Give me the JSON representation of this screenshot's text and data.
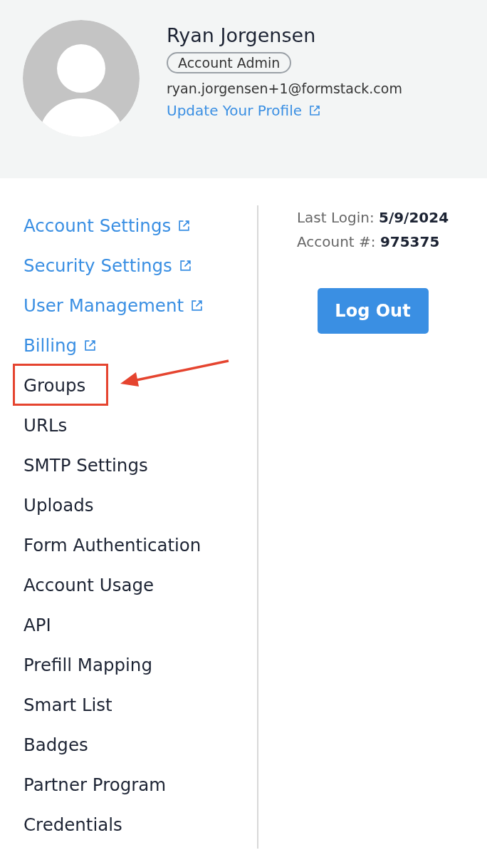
{
  "profile": {
    "name": "Ryan Jorgensen",
    "role": "Account Admin",
    "email": "ryan.jorgensen+1@formstack.com",
    "link": "Update Your Profile"
  },
  "menu": [
    {
      "label": "Account Settings",
      "external": true,
      "highlighted": false
    },
    {
      "label": "Security Settings",
      "external": true,
      "highlighted": false
    },
    {
      "label": "User Management",
      "external": true,
      "highlighted": false
    },
    {
      "label": "Billing",
      "external": true,
      "highlighted": false
    },
    {
      "label": "Groups",
      "external": false,
      "highlighted": true
    },
    {
      "label": "URLs",
      "external": false,
      "highlighted": false
    },
    {
      "label": "SMTP Settings",
      "external": false,
      "highlighted": false
    },
    {
      "label": "Uploads",
      "external": false,
      "highlighted": false
    },
    {
      "label": "Form Authentication",
      "external": false,
      "highlighted": false
    },
    {
      "label": "Account Usage",
      "external": false,
      "highlighted": false
    },
    {
      "label": "API",
      "external": false,
      "highlighted": false
    },
    {
      "label": "Prefill Mapping",
      "external": false,
      "highlighted": false
    },
    {
      "label": "Smart List",
      "external": false,
      "highlighted": false
    },
    {
      "label": "Badges",
      "external": false,
      "highlighted": false
    },
    {
      "label": "Partner Program",
      "external": false,
      "highlighted": false
    },
    {
      "label": "Credentials",
      "external": false,
      "highlighted": false
    }
  ],
  "info": [
    {
      "label": "Last Login:",
      "value": "5/9/2024"
    },
    {
      "label": "Account #:",
      "value": "975375"
    }
  ],
  "logout_button": "Log Out"
}
